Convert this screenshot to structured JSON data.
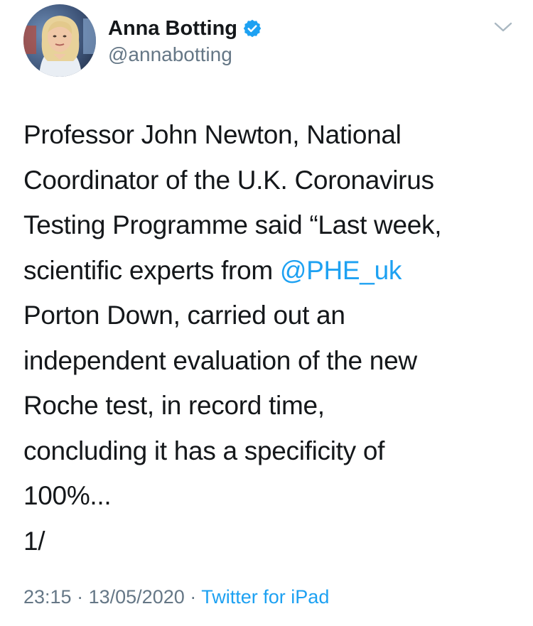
{
  "author": {
    "display_name": "Anna Botting",
    "handle": "@annabotting",
    "verified": true,
    "avatar_icon": "profile-photo"
  },
  "tweet": {
    "lines": [
      "Professor John Newton, National",
      "Coordinator of the U.K. Coronavirus",
      "Testing Programme said “Last week,",
      "scientific experts from ",
      "Porton Down, carried out an",
      "independent evaluation of the new",
      "Roche test, in record time,",
      "concluding it has a specificity of",
      "100%...",
      "1/"
    ],
    "mention": "@PHE_uk"
  },
  "meta": {
    "time": "23:15",
    "separator": "·",
    "date": "13/05/2020",
    "source": "Twitter for iPad"
  },
  "colors": {
    "link": "#1da1f2",
    "secondary": "#657786",
    "text": "#14171a"
  }
}
